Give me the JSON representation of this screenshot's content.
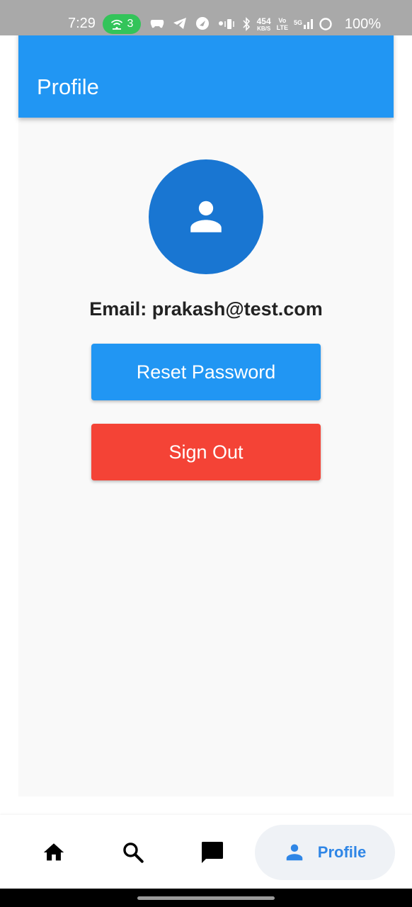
{
  "status_bar": {
    "time": "7:29",
    "hotspot_count": "3",
    "network_speed_value": "454",
    "network_speed_unit": "KB/S",
    "volte_top": "Vo",
    "volte_bottom": "LTE",
    "network_type": "5G",
    "battery": "100%"
  },
  "app_bar": {
    "title": "Profile"
  },
  "profile": {
    "email_text": "Email: prakash@test.com",
    "avatar_icon": "person-icon"
  },
  "actions": {
    "reset_password_label": "Reset Password",
    "sign_out_label": "Sign Out"
  },
  "bottom_nav": {
    "items": [
      {
        "icon": "home-icon",
        "label": ""
      },
      {
        "icon": "search-icon",
        "label": ""
      },
      {
        "icon": "chat-icon",
        "label": ""
      },
      {
        "icon": "person-icon",
        "label": "Profile",
        "active": true
      }
    ]
  },
  "colors": {
    "primary": "#2196f3",
    "avatar": "#1976d2",
    "danger": "#f44336",
    "active_nav_text": "#2f86e6"
  }
}
